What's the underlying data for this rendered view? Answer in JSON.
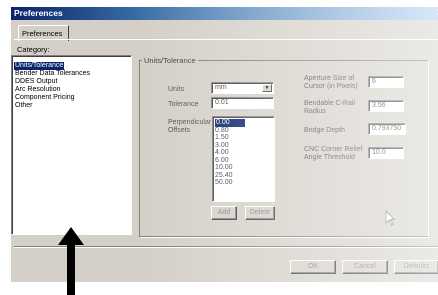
{
  "window": {
    "title": "Preferences"
  },
  "tabs": [
    {
      "label": "Preferences"
    }
  ],
  "category": {
    "label": "Category:",
    "items": [
      {
        "label": "Units/Tolerance",
        "selected": true
      },
      {
        "label": "Bender Data Tolerances",
        "selected": false
      },
      {
        "label": "DDES Output",
        "selected": false
      },
      {
        "label": "Arc Resolution",
        "selected": false
      },
      {
        "label": "Component Pricing",
        "selected": false
      },
      {
        "label": "Other",
        "selected": false
      }
    ]
  },
  "group": {
    "title": "Units/Tolerance"
  },
  "units": {
    "label": "Units",
    "value": "mm"
  },
  "tolerance": {
    "label": "Tolerance",
    "value": "0.01"
  },
  "perpendicular_offsets": {
    "label_line1": "Perpendicular",
    "label_line2": "Offsets",
    "options": [
      "0.00",
      "0.80",
      "1.50",
      "3.00",
      "4.00",
      "6.00",
      "10.00",
      "25.40",
      "50.00"
    ],
    "selected": "0.00"
  },
  "aperture": {
    "label_line1": "Aperture Size of",
    "label_line2": "Cursor (in Pixels)",
    "value": "6"
  },
  "bendable_c_rail": {
    "label_line1": "Bendable C-Rail",
    "label_line2": "Radius",
    "value": "3.56"
  },
  "bridge_depth": {
    "label": "Bridge Depth",
    "value": "0.793750"
  },
  "cnc_corner_relief": {
    "label_line1": "CNC Corner Relief",
    "label_line2": "Angle Threshold",
    "value": "10.0"
  },
  "list_buttons": {
    "add": "Add",
    "delete": "Delete"
  },
  "dialog_buttons": {
    "ok": "OK",
    "cancel": "Cancel",
    "defaults": "Defaults"
  },
  "colors": {
    "title_bar": "#0a246a",
    "dialog_face": "#d4d0c8",
    "selection": "#0a246a"
  },
  "icons": {
    "mouse_cursor": "arrow-cursor-icon",
    "annotation": "up-arrow-icon"
  }
}
